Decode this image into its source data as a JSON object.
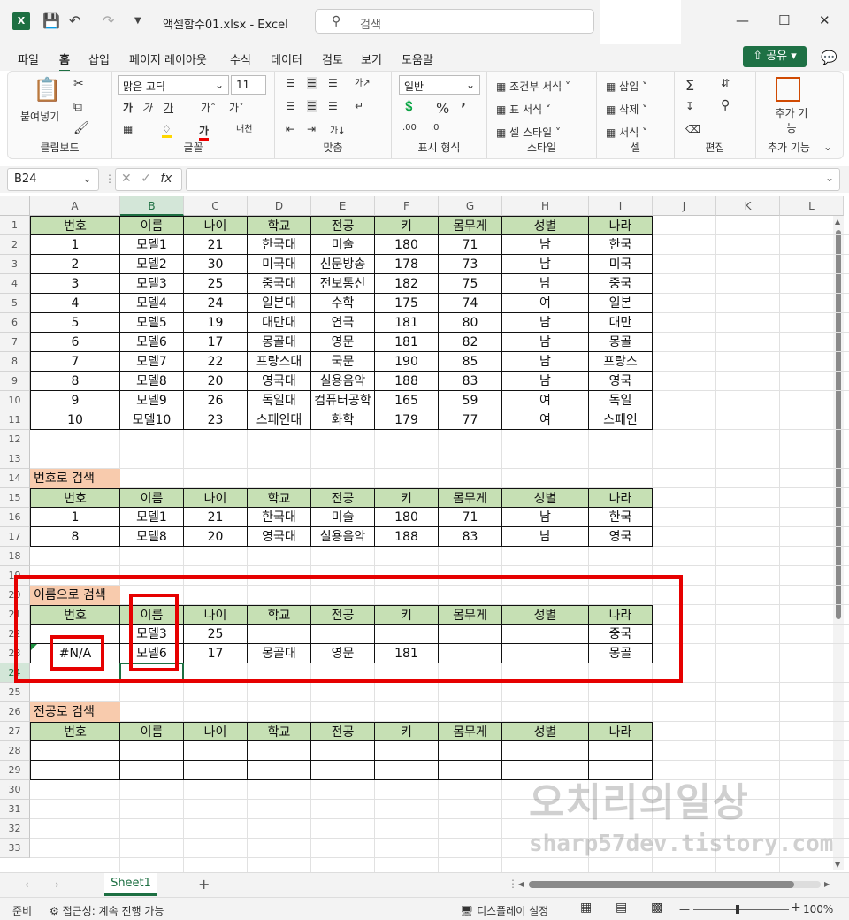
{
  "title": {
    "filename": "액셀함수01.xlsx",
    "app": "Excel",
    "sep": "-",
    "search_placeholder": "검색"
  },
  "menu": [
    "파일",
    "홈",
    "삽입",
    "페이지 레이아웃",
    "수식",
    "데이터",
    "검토",
    "보기",
    "도움말"
  ],
  "share_label": "공유",
  "ribbon": {
    "paste": "붙여넣기",
    "clipboard": "클립보드",
    "font_name": "맑은 고딕",
    "font_size": "11",
    "font_group": "글꼴",
    "align_group": "맞춤",
    "number_format": "일반",
    "number_group": "표시 형식",
    "cond_format": "조건부 서식",
    "table_format": "표 서식",
    "cell_style": "셀 스타일",
    "style_group": "스타일",
    "insert": "삽입",
    "delete": "삭제",
    "format": "서식",
    "cells_group": "셀",
    "edit_group": "편집",
    "addin": "추가 기능",
    "addin_group": "추가 기능"
  },
  "namebox": "B24",
  "columns": [
    "A",
    "B",
    "C",
    "D",
    "E",
    "F",
    "G",
    "H",
    "I",
    "J",
    "K",
    "L"
  ],
  "rows": [
    "1",
    "2",
    "3",
    "4",
    "5",
    "6",
    "7",
    "8",
    "9",
    "10",
    "11",
    "12",
    "13",
    "14",
    "15",
    "16",
    "17",
    "18",
    "19",
    "20",
    "21",
    "22",
    "23",
    "24",
    "25",
    "26",
    "27",
    "28",
    "29",
    "30",
    "31",
    "32",
    "33"
  ],
  "headers": [
    "번호",
    "이름",
    "나이",
    "학교",
    "전공",
    "키",
    "몸무게",
    "성별",
    "나라"
  ],
  "main_table": [
    [
      "1",
      "모델1",
      "21",
      "한국대",
      "미술",
      "180",
      "71",
      "남",
      "한국"
    ],
    [
      "2",
      "모델2",
      "30",
      "미국대",
      "신문방송",
      "178",
      "73",
      "남",
      "미국"
    ],
    [
      "3",
      "모델3",
      "25",
      "중국대",
      "전보통신",
      "182",
      "75",
      "남",
      "중국"
    ],
    [
      "4",
      "모델4",
      "24",
      "일본대",
      "수학",
      "175",
      "74",
      "여",
      "일본"
    ],
    [
      "5",
      "모델5",
      "19",
      "대만대",
      "연극",
      "181",
      "80",
      "남",
      "대만"
    ],
    [
      "6",
      "모델6",
      "17",
      "몽골대",
      "영문",
      "181",
      "82",
      "남",
      "몽골"
    ],
    [
      "7",
      "모델7",
      "22",
      "프랑스대",
      "국문",
      "190",
      "85",
      "남",
      "프랑스"
    ],
    [
      "8",
      "모델8",
      "20",
      "영국대",
      "실용음악",
      "188",
      "83",
      "남",
      "영국"
    ],
    [
      "9",
      "모델9",
      "26",
      "독일대",
      "컴퓨터공학",
      "165",
      "59",
      "여",
      "독일"
    ],
    [
      "10",
      "모델10",
      "23",
      "스페인대",
      "화학",
      "179",
      "77",
      "여",
      "스페인"
    ]
  ],
  "section1": {
    "label": "번호로 검색",
    "rows": [
      [
        "1",
        "모델1",
        "21",
        "한국대",
        "미술",
        "180",
        "71",
        "남",
        "한국"
      ],
      [
        "8",
        "모델8",
        "20",
        "영국대",
        "실용음악",
        "188",
        "83",
        "남",
        "영국"
      ]
    ]
  },
  "section2": {
    "label": "이름으로 검색",
    "rows": [
      [
        "",
        "모델3",
        "25",
        "",
        "",
        "",
        "",
        "",
        "중국"
      ],
      [
        "#N/A",
        "모델6",
        "17",
        "몽골대",
        "영문",
        "181",
        "",
        "",
        "몽골"
      ]
    ]
  },
  "section3": {
    "label": "전공로 검색",
    "rows": [
      [
        "",
        "",
        "",
        "",
        "",
        "",
        "",
        "",
        ""
      ],
      [
        "",
        "",
        "",
        "",
        "",
        "",
        "",
        "",
        ""
      ]
    ]
  },
  "sheet_tab": "Sheet1",
  "status": {
    "ready": "준비",
    "accessibility": "접근성: 계속 진행 가능",
    "display": "디스플레이 설정",
    "zoom": "100%"
  },
  "watermark": {
    "line1": "오치리의일상",
    "line2": "sharp57dev.tistory.com"
  }
}
